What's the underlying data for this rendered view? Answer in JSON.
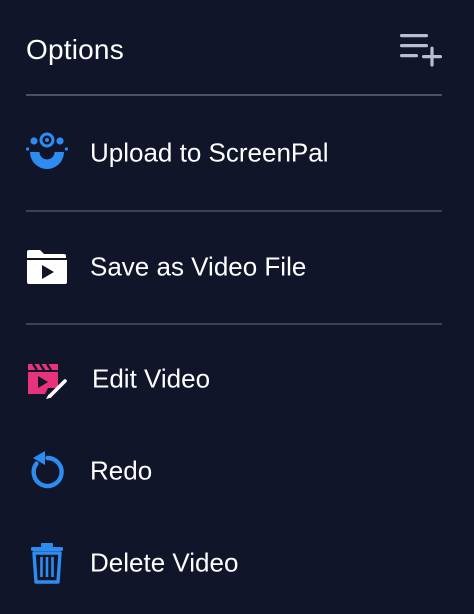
{
  "panel": {
    "title": "Options",
    "header_icon": "add-to-list-icon"
  },
  "items": [
    {
      "label": "Upload to ScreenPal",
      "icon": "screenpal-logo-icon",
      "icon_color": "#2d8cf0"
    },
    {
      "label": "Save as Video File",
      "icon": "video-folder-icon",
      "icon_color": "#ffffff"
    },
    {
      "label": "Edit Video",
      "icon": "edit-video-icon",
      "icon_color": "#e8327c"
    },
    {
      "label": "Redo",
      "icon": "redo-icon",
      "icon_color": "#2d8cf0"
    },
    {
      "label": "Delete Video",
      "icon": "trash-icon",
      "icon_color": "#2d8cf0"
    }
  ],
  "colors": {
    "background": "#10152a",
    "divider": "#3a4058",
    "accent_blue": "#2d8cf0",
    "accent_pink": "#e8327c"
  }
}
